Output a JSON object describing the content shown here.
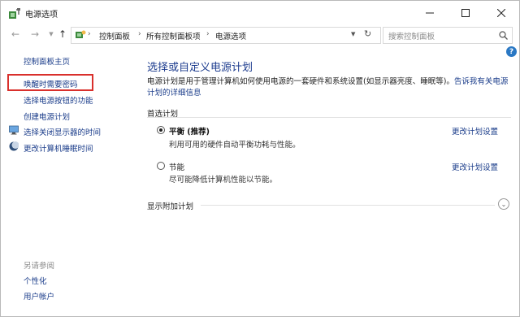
{
  "window": {
    "title": "电源选项"
  },
  "address": {
    "crumbs": [
      "控制面板",
      "所有控制面板项",
      "电源选项"
    ],
    "search_placeholder": "搜索控制面板"
  },
  "sidebar": {
    "items": [
      {
        "label": "控制面板主页",
        "icon": "none"
      },
      {
        "label": "唤醒时需要密码",
        "icon": "none",
        "highlighted": true
      },
      {
        "label": "选择电源按钮的功能",
        "icon": "none"
      },
      {
        "label": "创建电源计划",
        "icon": "none"
      },
      {
        "label": "选择关闭显示器的时间",
        "icon": "monitor-icon"
      },
      {
        "label": "更改计算机睡眠时间",
        "icon": "moon-icon"
      }
    ],
    "see_also": {
      "title": "另请参阅",
      "items": [
        "个性化",
        "用户帐户"
      ]
    }
  },
  "main": {
    "heading": "选择或自定义电源计划",
    "desc_line1": "电源计划是用于管理计算机如何使用电源的一套硬件和系统设置(如显示器亮度、睡眠等)。",
    "desc_link_part1": "告诉我有关电源",
    "desc_link_part2": "计划的详细信息",
    "section_label": "首选计划",
    "plans": [
      {
        "name": "平衡 (推荐)",
        "desc": "利用可用的硬件自动平衡功耗与性能。",
        "selected": true,
        "link": "更改计划设置"
      },
      {
        "name": "节能",
        "desc": "尽可能降低计算机性能以节能。",
        "selected": false,
        "link": "更改计划设置"
      }
    ],
    "more_plans": "显示附加计划"
  },
  "colors": {
    "link": "#1a3c8a",
    "heading": "#1e3d8f",
    "highlight": "#d9302c",
    "help": "#2a78c4"
  }
}
